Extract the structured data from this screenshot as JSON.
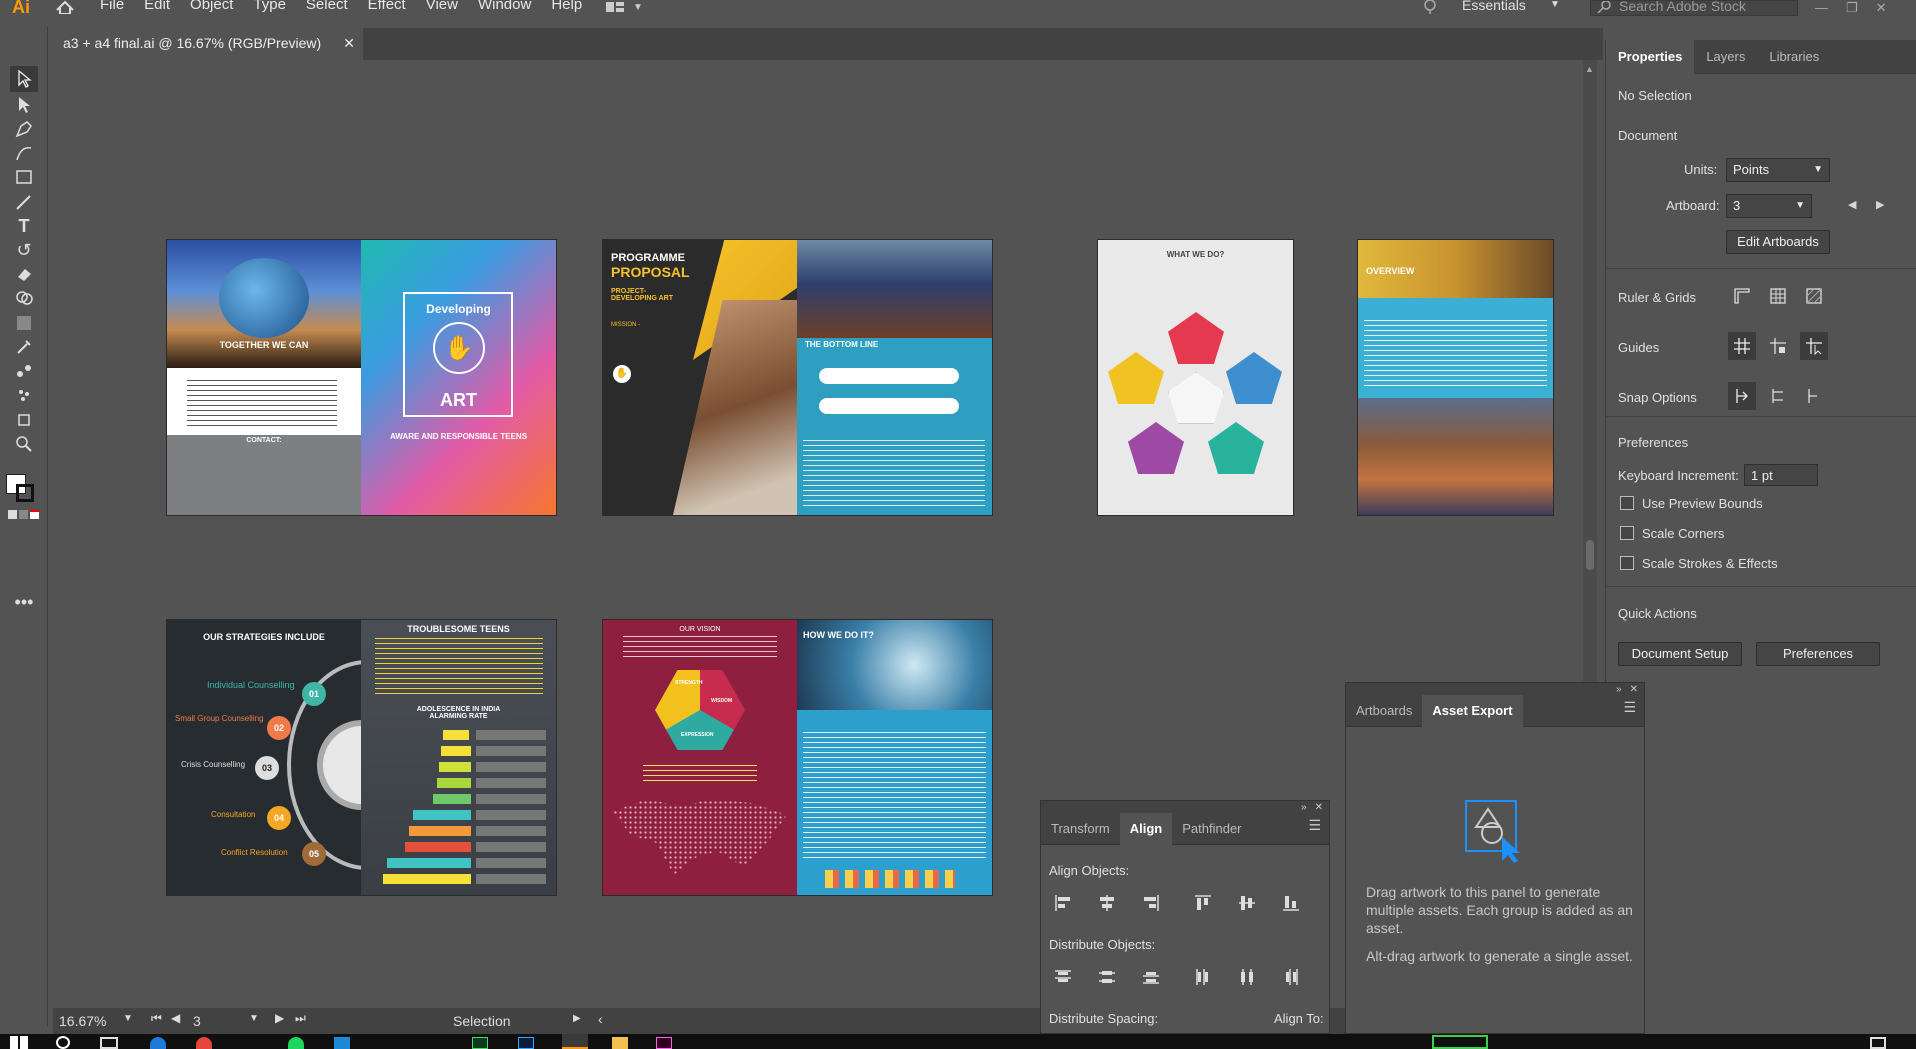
{
  "app": {
    "logo": "Ai"
  },
  "menubar": {
    "items": [
      "File",
      "Edit",
      "Object",
      "Type",
      "Select",
      "Effect",
      "View",
      "Window",
      "Help"
    ],
    "workspace": "Essentials",
    "search_placeholder": "Search Adobe Stock"
  },
  "document": {
    "tab_title": "a3 + a4 final.ai @ 16.67% (RGB/Preview)"
  },
  "status": {
    "zoom": "16.67%",
    "artboard": "3",
    "tool": "Selection"
  },
  "properties": {
    "tabs": [
      "Properties",
      "Layers",
      "Libraries"
    ],
    "selection": "No Selection",
    "document_label": "Document",
    "units_label": "Units:",
    "units_value": "Points",
    "artboard_label": "Artboard:",
    "artboard_value": "3",
    "edit_artboards": "Edit Artboards",
    "ruler_grids": "Ruler & Grids",
    "guides": "Guides",
    "snap_options": "Snap Options",
    "preferences_label": "Preferences",
    "keyboard_increment_label": "Keyboard Increment:",
    "keyboard_increment_value": "1 pt",
    "use_preview_bounds": "Use Preview Bounds",
    "scale_corners": "Scale Corners",
    "scale_strokes": "Scale Strokes & Effects",
    "quick_actions": "Quick Actions",
    "document_setup": "Document Setup",
    "preferences_btn": "Preferences"
  },
  "asset_export": {
    "tabs": [
      "Artboards",
      "Asset Export"
    ],
    "text1": "Drag artwork to this panel to generate multiple assets. Each group is added as an asset.",
    "text2": "Alt-drag artwork to generate a single asset."
  },
  "align": {
    "tabs": [
      "Transform",
      "Align",
      "Pathfinder"
    ],
    "align_objects": "Align Objects:",
    "distribute_objects": "Distribute Objects:",
    "distribute_spacing": "Distribute Spacing:",
    "align_to": "Align To:"
  },
  "artboards": {
    "a1_left_title": "TOGETHER WE CAN",
    "a1_contact": "CONTACT:",
    "a1_right_title": "Developing",
    "a1_right_art": "ART",
    "a1_right_sub": "AWARE AND RESPONSIBLE TEENS",
    "a2_title1": "PROGRAMME",
    "a2_title2": "PROPOSAL",
    "a2_project": "PROJECT- DEVELOPING ART",
    "a2_mission": "MISSION -",
    "a2_bottom": "THE BOTTOM LINE",
    "a3_title": "WHAT WE DO?",
    "a4_title": "OVERVIEW",
    "a5_left_title": "OUR STRATEGIES INCLUDE",
    "a5_items": [
      "Individual Counselling",
      "Small Group Counselling",
      "Crisis Counselling",
      "Consultation",
      "Conflict Resolution"
    ],
    "a5_nums": [
      "01",
      "02",
      "03",
      "04",
      "05"
    ],
    "a5_right_title": "TROUBLESOME TEENS",
    "a5_right_sub": "ADOLESCENCE IN INDIA ALARMING RATE",
    "a6_vision": "OUR VISION",
    "a6_how": "HOW WE DO IT?",
    "a6_hex": [
      "STRENGTH",
      "WISDOM",
      "EXPRESSION"
    ]
  }
}
